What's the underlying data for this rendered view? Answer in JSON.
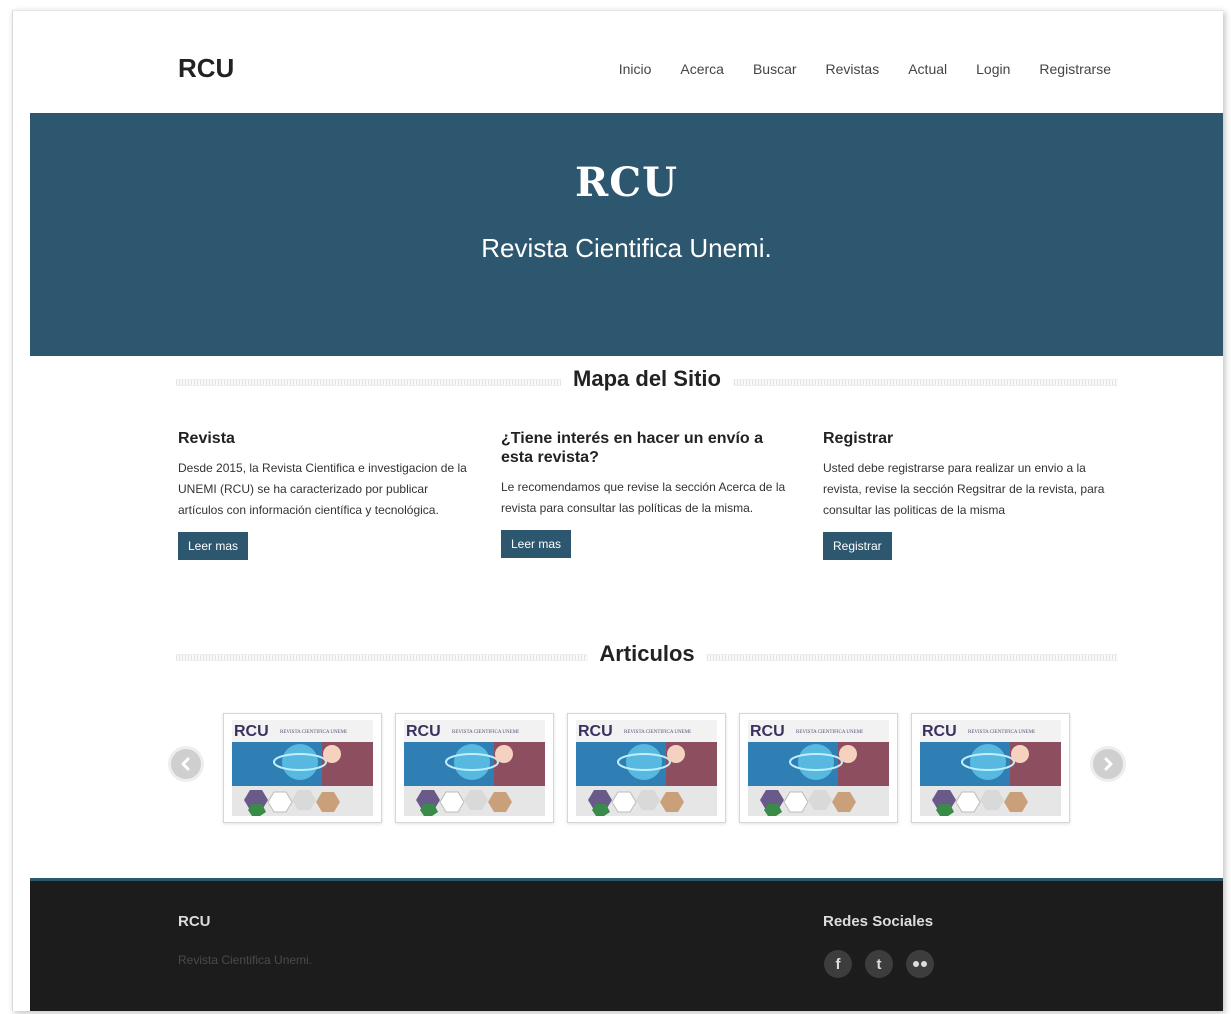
{
  "brand": "RCU",
  "nav": [
    "Inicio",
    "Acerca",
    "Buscar",
    "Revistas",
    "Actual",
    "Login",
    "Registrarse"
  ],
  "hero": {
    "title": "RCU",
    "subtitle": "Revista Cientifica Unemi."
  },
  "sitemap": {
    "heading": "Mapa del Sitio",
    "columns": [
      {
        "title": "Revista",
        "text": "Desde 2015, la Revista Cientifica e investigacion de la UNEMI (RCU) se ha caracterizado por publicar artículos con información científica y tecnológica.",
        "button": "Leer mas"
      },
      {
        "title": "¿Tiene interés en hacer un envío a esta revista?",
        "text": "Le recomendamos que revise la sección Acerca de la revista para consultar las políticas de la misma.",
        "button": "Leer mas"
      },
      {
        "title": "Registrar",
        "text": "Usted debe registrarse para realizar un envio a la revista, revise la sección Regsitrar de la revista, para consultar las politicas de la misma",
        "button": "Registrar"
      }
    ]
  },
  "articles": {
    "heading": "Articulos",
    "cover_logo": "RCU",
    "cover_subtitle": "REVISTA CIENTIFICA UNEMI",
    "count_visible": 5,
    "prev_icon": "chevron-left-icon",
    "next_icon": "chevron-right-icon"
  },
  "footer": {
    "brand": "RCU",
    "tagline": "Revista Cientifica Unemi.",
    "social_title": "Redes Sociales",
    "social_icons": [
      "facebook-icon",
      "twitter-icon",
      "flickr-icon"
    ]
  },
  "colors": {
    "primary": "#2d566f",
    "footer_bg": "#1c1c1c"
  }
}
